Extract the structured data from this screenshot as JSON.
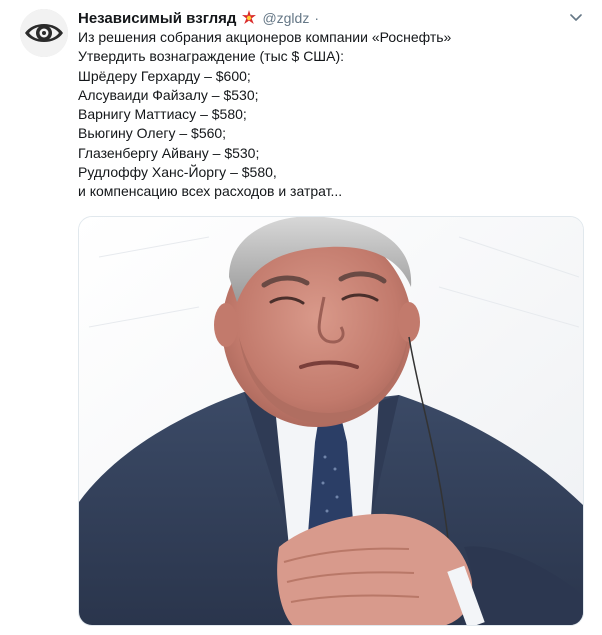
{
  "author": {
    "display_name": "Независимый взгляд",
    "badge_icon": "red-star-badge-icon",
    "handle": "@zgldz",
    "separator": "·",
    "avatar_icon": "eye-logo-icon"
  },
  "menu": {
    "icon": "chevron-down-icon"
  },
  "tweet": {
    "lines": [
      "Из решения собрания акционеров компании «Роснефть»",
      "Утвердить вознаграждение (тыс $ США):",
      "Шрёдеру Герхарду – $600;",
      "Алсуваиди Файзалу – $530;",
      "Варнигу Маттиасу – $580;",
      "Вьюгину Олегу – $560;",
      "Глазенбергу Айвану – $530;",
      "Рудлоффу Ханс-Йоргу – $580,",
      "и компенсацию всех расходов и затрат..."
    ]
  },
  "media": {
    "kind": "photo",
    "subject": "man-in-suit-hand-on-chest"
  },
  "colors": {
    "text": "#14171a",
    "secondary": "#657786",
    "border": "#e1e8ed",
    "badge": "#e0245e"
  }
}
